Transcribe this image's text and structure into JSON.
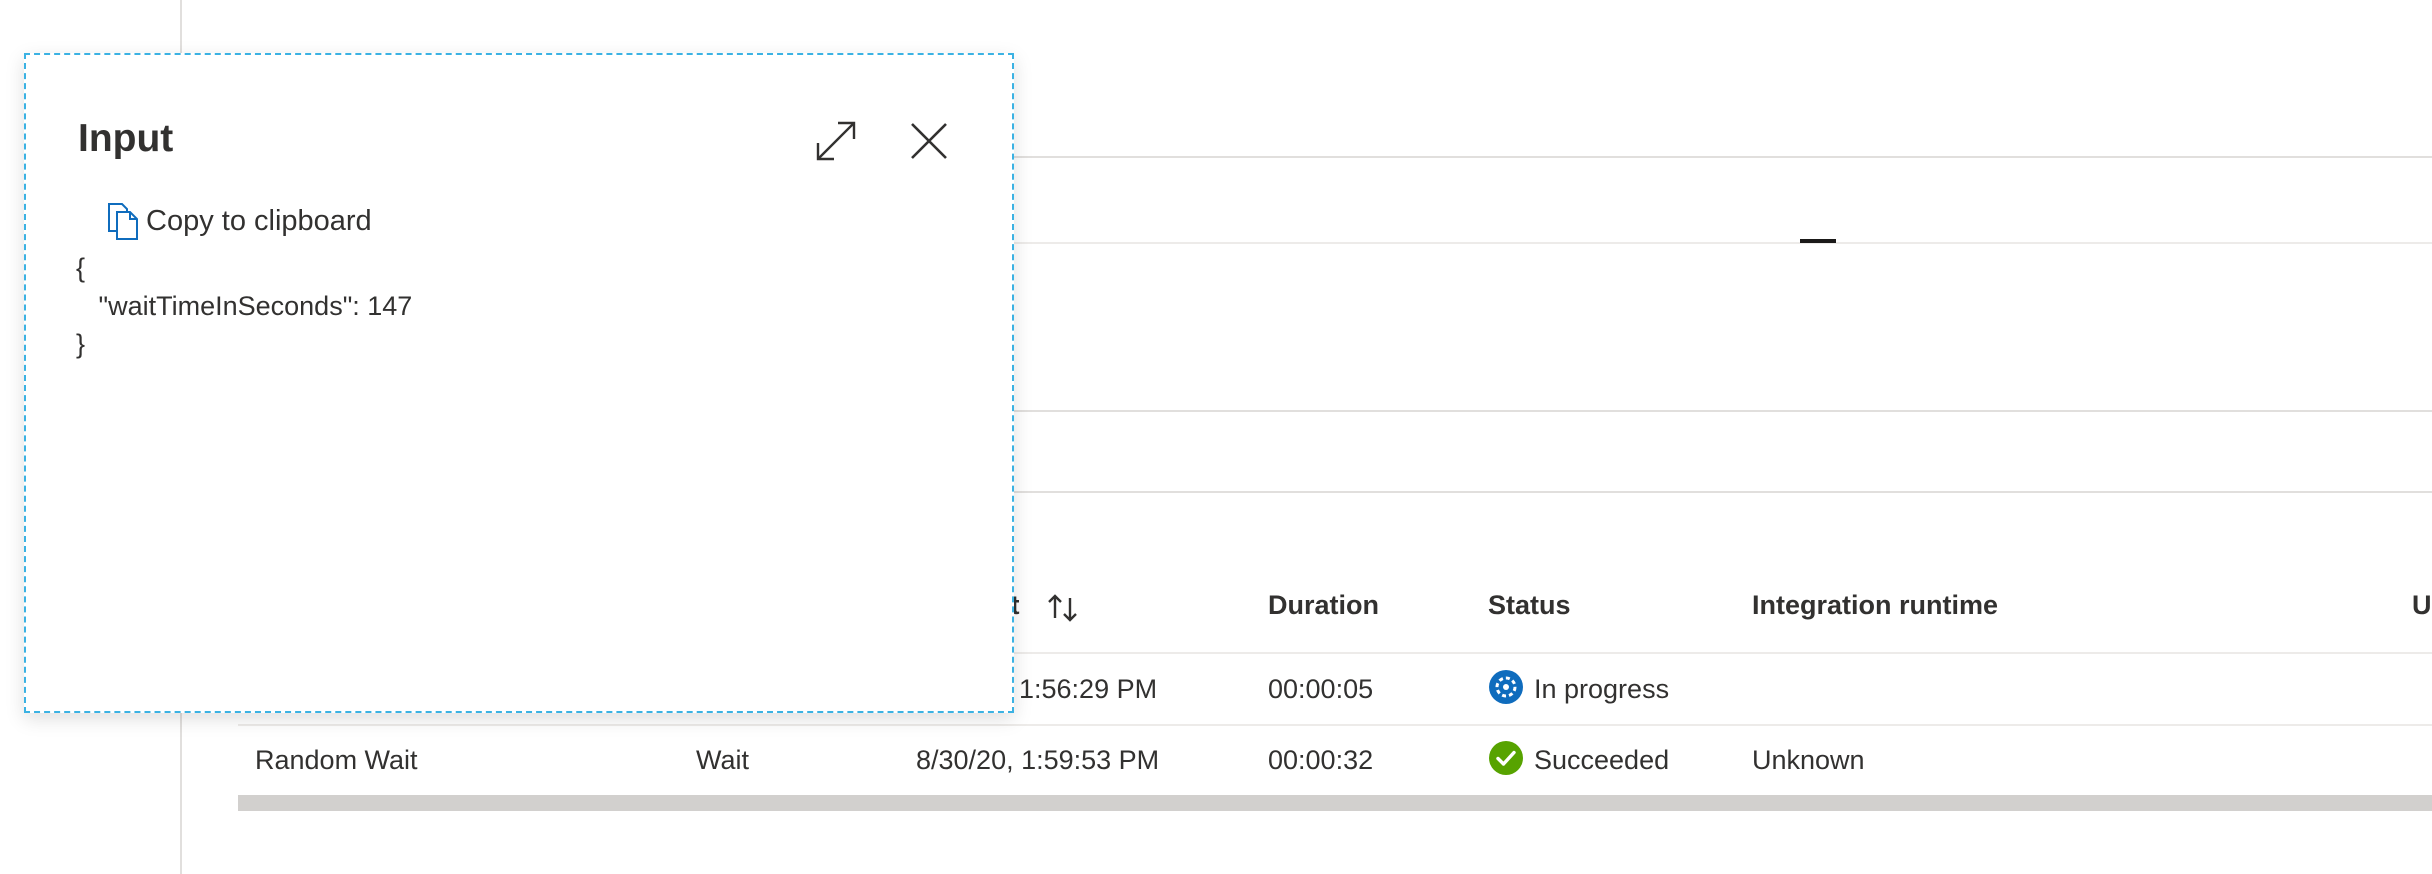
{
  "flyout": {
    "title": "Input",
    "copy_label": "Copy to clipboard",
    "code_lines": [
      "{",
      "   \"waitTimeInSeconds\": 147",
      "}"
    ],
    "icons": {
      "expand": "expand-icon",
      "close": "close-icon",
      "copy": "copy-icon"
    }
  },
  "table": {
    "headers": {
      "start_partial": "rt",
      "duration": "Duration",
      "status": "Status",
      "integration_runtime": "Integration runtime",
      "next_partial": "U"
    },
    "rows": [
      {
        "name": "",
        "type": "",
        "start": ", 1:56:29 PM",
        "duration": "00:00:05",
        "status": "In progress",
        "status_color": "#0f6cbd",
        "integration_runtime": ""
      },
      {
        "name": "Random Wait",
        "type": "Wait",
        "start": "8/30/20, 1:59:53 PM",
        "duration": "00:00:32",
        "status": "Succeeded",
        "status_color": "#57a300",
        "integration_runtime": "Unknown"
      }
    ]
  },
  "colors": {
    "flyout_border": "#3bb2e3",
    "divider": "#e1dfdd"
  }
}
